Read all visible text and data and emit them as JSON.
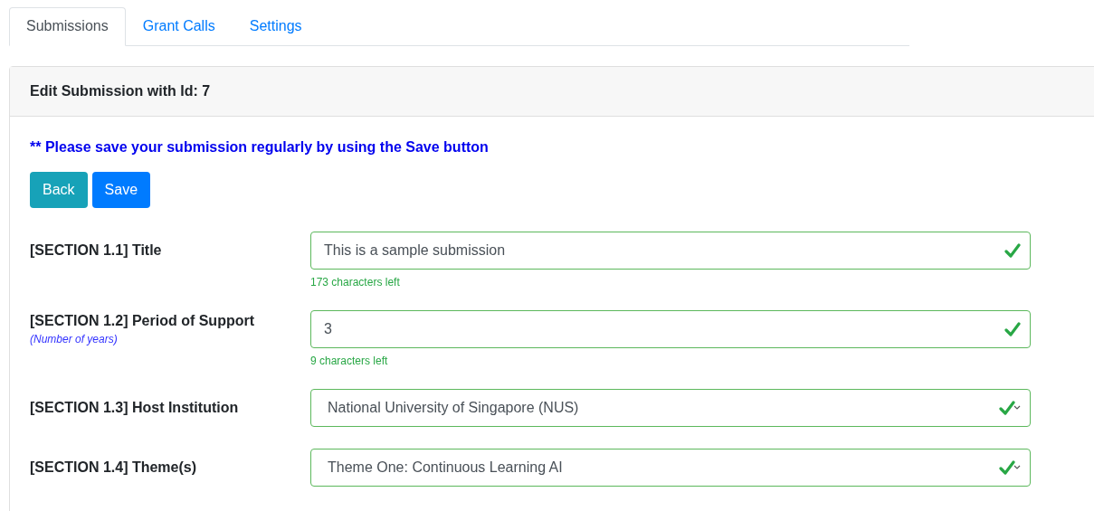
{
  "tabs": [
    {
      "label": "Submissions",
      "selected": true
    },
    {
      "label": "Grant Calls",
      "selected": false
    },
    {
      "label": "Settings",
      "selected": false
    }
  ],
  "card": {
    "title": "Edit Submission with Id: 7",
    "notice": "** Please save your submission regularly by using the Save button"
  },
  "buttons": [
    {
      "label": "Back",
      "kind": "info"
    },
    {
      "label": "Save",
      "kind": "primary"
    }
  ],
  "fields": [
    {
      "label": "[SECTION 1.1] Title",
      "kind": "text",
      "value": "This is a sample submission",
      "valid": true,
      "hint": "173 characters left"
    },
    {
      "label": "[SECTION 1.2] Period of Support",
      "sublabel": "(Number of years)",
      "kind": "text",
      "value": "3",
      "valid": true,
      "hint": "9 characters left"
    },
    {
      "label": "[SECTION 1.3] Host Institution",
      "kind": "select",
      "value": "National University of Singapore (NUS)",
      "valid": true
    },
    {
      "label": "[SECTION 1.4] Theme(s)",
      "kind": "select",
      "value": "Theme One: Continuous Learning AI",
      "valid": true
    }
  ]
}
